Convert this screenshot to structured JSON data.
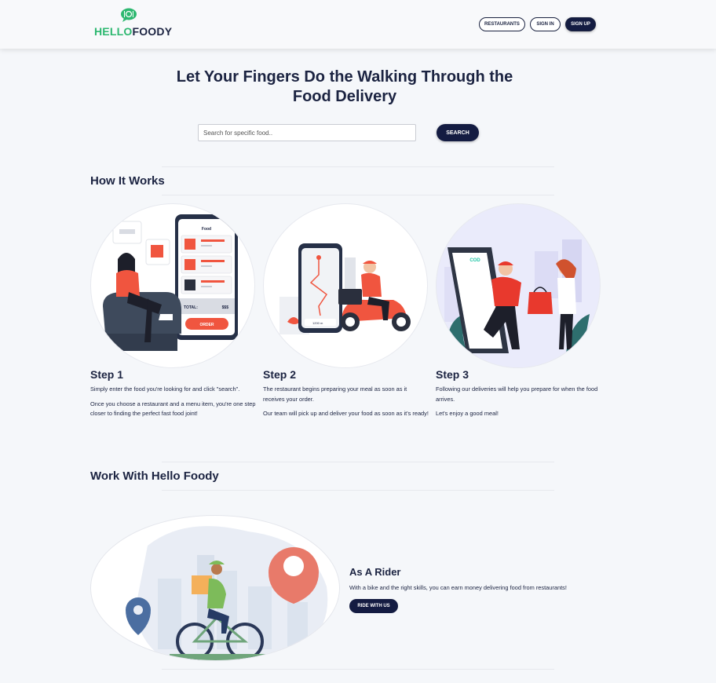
{
  "header": {
    "logo_hello": "HELLO",
    "logo_foody": "FOODY",
    "nav": {
      "restaurants": "RESTAURANTS",
      "sign_in": "SIGN IN",
      "sign_up": "SIGN UP"
    }
  },
  "hero": {
    "title": "Let Your Fingers Do the Walking Through the Food Delivery",
    "search_placeholder": "Search for specific food..",
    "search_button": "SEARCH"
  },
  "how_it_works": {
    "title": "How It Works",
    "steps": [
      {
        "title": "Step 1",
        "paragraphs": [
          "Simply enter the food you're looking for and click \"search\".",
          "Once you choose a restaurant and a menu item, you're one step closer to finding the perfect fast food joint!"
        ],
        "illustration": {
          "phone_title": "Food",
          "total_label": "TOTAL:",
          "total_value": "$$$",
          "order_button": "ORDER"
        }
      },
      {
        "title": "Step 2",
        "paragraphs": [
          "The restaurant begins preparing your meal as soon as it receives your order.",
          "Our team will pick up and deliver your food as soon as it's ready!"
        ],
        "illustration": {
          "distance": "1200 m"
        }
      },
      {
        "title": "Step 3",
        "paragraphs": [
          "Following our deliveries will help you prepare for when the food arrives.",
          "Let's enjoy a good meal!"
        ],
        "illustration": {
          "phone_label": "COD"
        }
      }
    ]
  },
  "work_with": {
    "title": "Work With Hello Foody",
    "rider_title": "As A Rider",
    "rider_text": "With a bike and the right skills, you can earn money delivering food from restaurants!",
    "rider_button": "RIDE WITH US"
  },
  "colors": {
    "navy": "#141c42",
    "brand_green": "#2db870",
    "accent_red": "#f0553f",
    "background": "#f5f7fa"
  }
}
